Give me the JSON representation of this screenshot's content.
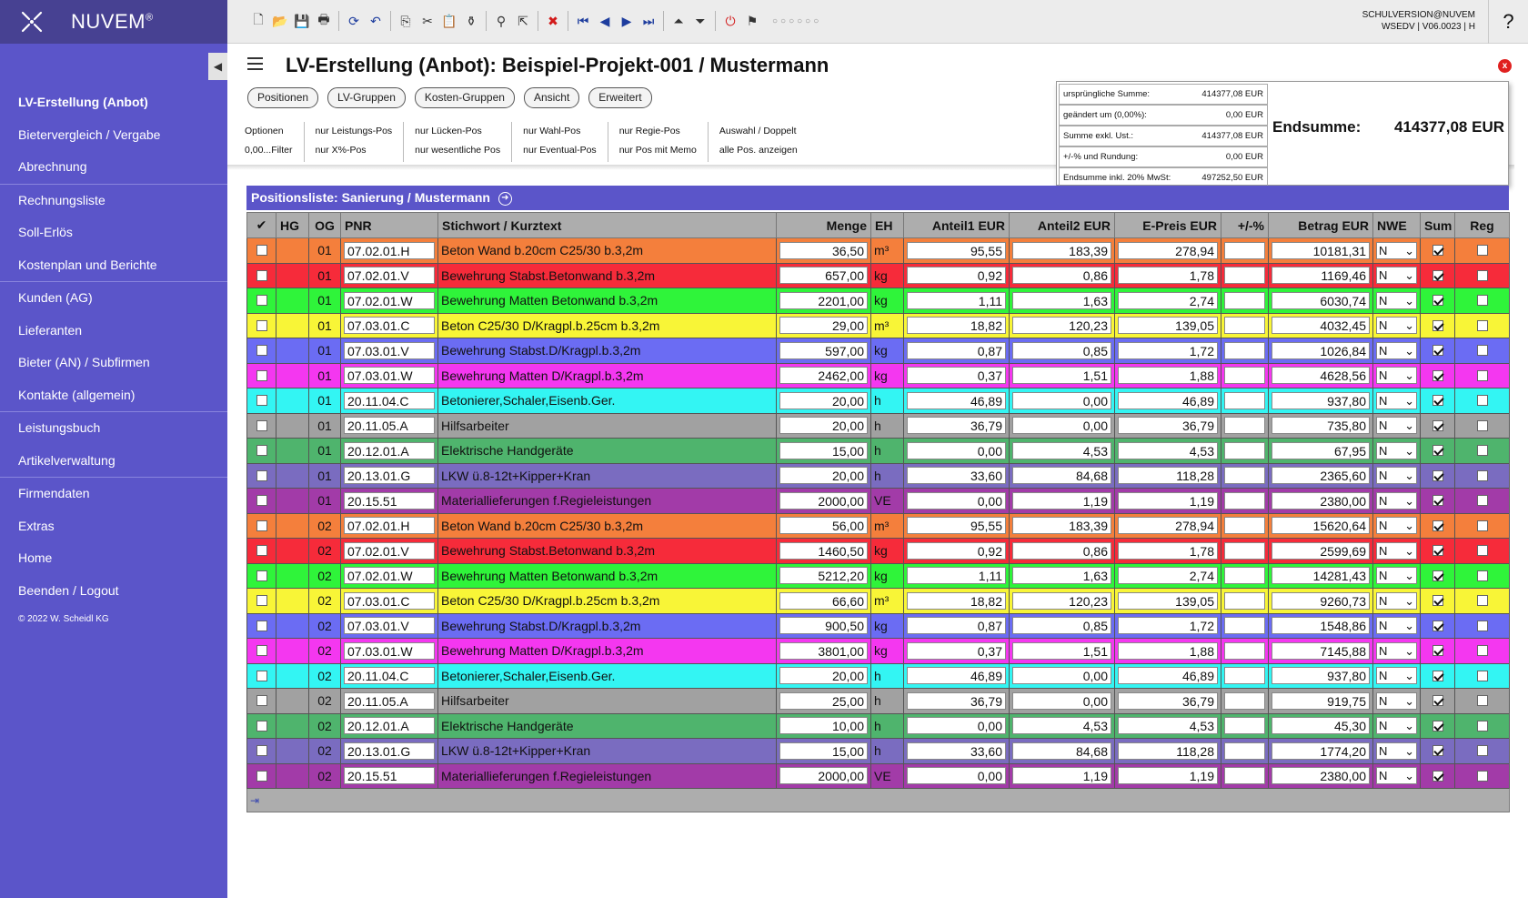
{
  "app": {
    "name": "NUVEM",
    "trademark": "®"
  },
  "user": {
    "line1": "SCHULVERSION@NUVEM",
    "line2": "WSEDV | V06.0023 | H"
  },
  "help_label": "?",
  "sidebar": {
    "groups": [
      [
        {
          "label": "LV-Erstellung (Anbot)",
          "active": true
        },
        {
          "label": "Bietervergleich / Vergabe"
        },
        {
          "label": "Abrechnung"
        }
      ],
      [
        {
          "label": "Rechnungsliste"
        },
        {
          "label": "Soll-Erlös"
        },
        {
          "label": "Kostenplan und Berichte"
        }
      ],
      [
        {
          "label": "Kunden (AG)"
        },
        {
          "label": "Lieferanten"
        },
        {
          "label": "Bieter (AN) / Subfirmen"
        },
        {
          "label": "Kontakte (allgemein)"
        }
      ],
      [
        {
          "label": "Leistungsbuch"
        },
        {
          "label": "Artikelverwaltung"
        }
      ],
      [
        {
          "label": "Firmendaten"
        },
        {
          "label": "Extras"
        },
        {
          "label": "Home"
        },
        {
          "label": "Beenden / Logout"
        }
      ]
    ],
    "copyright": "© 2022 W. Scheidl KG",
    "collapse_icon": "◀"
  },
  "toolbar": {
    "icons": [
      {
        "name": "new-document-icon",
        "glyph": "🗋"
      },
      {
        "name": "open-folder-icon",
        "glyph": "📂"
      },
      {
        "name": "save-icon",
        "glyph": "💾"
      },
      {
        "name": "print-icon",
        "glyph": "🖶"
      },
      {
        "sep": true
      },
      {
        "name": "refresh-icon",
        "glyph": "⟳",
        "color": "blue"
      },
      {
        "name": "undo-icon",
        "glyph": "↶",
        "color": "blue"
      },
      {
        "sep": true
      },
      {
        "name": "copy-icon",
        "glyph": "⎘"
      },
      {
        "name": "cut-icon",
        "glyph": "✂"
      },
      {
        "name": "paste-icon",
        "glyph": "📋"
      },
      {
        "name": "paste-special-icon",
        "glyph": "⚱"
      },
      {
        "sep": true
      },
      {
        "name": "search-icon",
        "glyph": "⚲"
      },
      {
        "name": "export-icon",
        "glyph": "⇱"
      },
      {
        "sep": true
      },
      {
        "name": "delete-icon",
        "glyph": "✖",
        "color": "red"
      },
      {
        "sep": true
      },
      {
        "name": "first-record-icon",
        "glyph": "⏮",
        "color": "blue"
      },
      {
        "name": "previous-record-icon",
        "glyph": "◀",
        "color": "blue"
      },
      {
        "name": "next-record-icon",
        "glyph": "▶",
        "color": "blue"
      },
      {
        "name": "last-record-icon",
        "glyph": "⏭",
        "color": "blue"
      },
      {
        "sep": true
      },
      {
        "name": "collapse-all-icon",
        "glyph": "⏶"
      },
      {
        "name": "expand-all-icon",
        "glyph": "⏷"
      },
      {
        "sep": true
      },
      {
        "name": "power-icon",
        "glyph": "⏻",
        "color": "red"
      },
      {
        "name": "notification-icon",
        "glyph": "⚑"
      }
    ],
    "pager_dots": "○○○○○○"
  },
  "page": {
    "title": "LV-Erstellung (Anbot): Beispiel-Projekt-001 / Mustermann",
    "close_label": "x"
  },
  "tabs": [
    "Positionen",
    "LV-Gruppen",
    "Kosten-Gruppen",
    "Ansicht",
    "Erweitert"
  ],
  "options": [
    [
      "Optionen",
      "0,00...Filter"
    ],
    [
      "nur Leistungs-Pos",
      "nur X%-Pos"
    ],
    [
      "nur Lücken-Pos",
      "nur wesentliche Pos"
    ],
    [
      "nur Wahl-Pos",
      "nur Eventual-Pos"
    ],
    [
      "nur Regie-Pos",
      "nur Pos mit Memo"
    ],
    [
      "Auswahl / Doppelt",
      "alle Pos. anzeigen"
    ]
  ],
  "summary": {
    "rows": [
      {
        "label": "ursprüngliche Summe:",
        "value": "414377,08 EUR"
      },
      {
        "label": "geändert um (0,00%):",
        "value": "0,00 EUR"
      },
      {
        "label": "Summe exkl. Ust.:",
        "value": "414377,08 EUR"
      },
      {
        "label": "+/-% und Rundung:",
        "value": "0,00 EUR"
      },
      {
        "label": "Endsumme inkl. 20% MwSt:",
        "value": "497252,50 EUR"
      }
    ],
    "endsumme_label": "Endsumme:",
    "endsumme_value": "414377,08 EUR"
  },
  "list": {
    "title": "Positionsliste: Sanierung / Mustermann",
    "columns": [
      "✔",
      "HG",
      "OG",
      "PNR",
      "Stichwort / Kurztext",
      "Menge",
      "EH",
      "Anteil1 EUR",
      "Anteil2 EUR",
      "E-Preis EUR",
      "+/-%",
      "Betrag EUR",
      "NWE",
      "Sum",
      "Reg"
    ],
    "footer_icon": "⇥",
    "rows": [
      {
        "color": "#f47f3c",
        "og": "01",
        "pnr": "07.02.01.H",
        "text": "Beton Wand b.20cm C25/30 b.3,2m",
        "menge": "36,50",
        "eh": "m³",
        "a1": "95,55",
        "a2": "183,39",
        "ep": "278,94",
        "pm": "",
        "betrag": "10181,31",
        "nwe": "N",
        "sum": true,
        "reg": false
      },
      {
        "color": "#f62b3a",
        "og": "01",
        "pnr": "07.02.01.V",
        "text": "Bewehrung Stabst.Betonwand b.3,2m",
        "menge": "657,00",
        "eh": "kg",
        "a1": "0,92",
        "a2": "0,86",
        "ep": "1,78",
        "pm": "",
        "betrag": "1169,46",
        "nwe": "N",
        "sum": true,
        "reg": false
      },
      {
        "color": "#2ff43a",
        "og": "01",
        "pnr": "07.02.01.W",
        "text": "Bewehrung Matten Betonwand b.3,2m",
        "menge": "2201,00",
        "eh": "kg",
        "a1": "1,11",
        "a2": "1,63",
        "ep": "2,74",
        "pm": "",
        "betrag": "6030,74",
        "nwe": "N",
        "sum": true,
        "reg": false
      },
      {
        "color": "#f8f537",
        "og": "01",
        "pnr": "07.03.01.C",
        "text": "Beton C25/30 D/Kragpl.b.25cm b.3,2m",
        "menge": "29,00",
        "eh": "m³",
        "a1": "18,82",
        "a2": "120,23",
        "ep": "139,05",
        "pm": "",
        "betrag": "4032,45",
        "nwe": "N",
        "sum": true,
        "reg": false
      },
      {
        "color": "#6b6cf3",
        "og": "01",
        "pnr": "07.03.01.V",
        "text": "Bewehrung Stabst.D/Kragpl.b.3,2m",
        "menge": "597,00",
        "eh": "kg",
        "a1": "0,87",
        "a2": "0,85",
        "ep": "1,72",
        "pm": "",
        "betrag": "1026,84",
        "nwe": "N",
        "sum": true,
        "reg": false
      },
      {
        "color": "#f437f0",
        "og": "01",
        "pnr": "07.03.01.W",
        "text": "Bewehrung Matten D/Kragpl.b.3,2m",
        "menge": "2462,00",
        "eh": "kg",
        "a1": "0,37",
        "a2": "1,51",
        "ep": "1,88",
        "pm": "",
        "betrag": "4628,56",
        "nwe": "N",
        "sum": true,
        "reg": false
      },
      {
        "color": "#33f5f3",
        "og": "01",
        "pnr": "20.11.04.C",
        "text": "Betonierer,Schaler,Eisenb.Ger.",
        "menge": "20,00",
        "eh": "h",
        "a1": "46,89",
        "a2": "0,00",
        "ep": "46,89",
        "pm": "",
        "betrag": "937,80",
        "nwe": "N",
        "sum": true,
        "reg": false
      },
      {
        "color": "#a1a1a1",
        "og": "01",
        "pnr": "20.11.05.A",
        "text": "Hilfsarbeiter",
        "menge": "20,00",
        "eh": "h",
        "a1": "36,79",
        "a2": "0,00",
        "ep": "36,79",
        "pm": "",
        "betrag": "735,80",
        "nwe": "N",
        "sum": true,
        "reg": false
      },
      {
        "color": "#4fb46d",
        "og": "01",
        "pnr": "20.12.01.A",
        "text": "Elektrische Handgeräte",
        "menge": "15,00",
        "eh": "h",
        "a1": "0,00",
        "a2": "4,53",
        "ep": "4,53",
        "pm": "",
        "betrag": "67,95",
        "nwe": "N",
        "sum": true,
        "reg": false
      },
      {
        "color": "#7a6cc0",
        "og": "01",
        "pnr": "20.13.01.G",
        "text": "LKW ü.8-12t+Kipper+Kran",
        "menge": "20,00",
        "eh": "h",
        "a1": "33,60",
        "a2": "84,68",
        "ep": "118,28",
        "pm": "",
        "betrag": "2365,60",
        "nwe": "N",
        "sum": true,
        "reg": false
      },
      {
        "color": "#a23ba8",
        "og": "01",
        "pnr": "20.15.51",
        "text": "Materiallieferungen f.Regieleistungen",
        "menge": "2000,00",
        "eh": "VE",
        "a1": "0,00",
        "a2": "1,19",
        "ep": "1,19",
        "pm": "",
        "betrag": "2380,00",
        "nwe": "N",
        "sum": true,
        "reg": false
      },
      {
        "color": "#f47f3c",
        "og": "02",
        "pnr": "07.02.01.H",
        "text": "Beton Wand b.20cm C25/30 b.3,2m",
        "menge": "56,00",
        "eh": "m³",
        "a1": "95,55",
        "a2": "183,39",
        "ep": "278,94",
        "pm": "",
        "betrag": "15620,64",
        "nwe": "N",
        "sum": true,
        "reg": false
      },
      {
        "color": "#f62b3a",
        "og": "02",
        "pnr": "07.02.01.V",
        "text": "Bewehrung Stabst.Betonwand b.3,2m",
        "menge": "1460,50",
        "eh": "kg",
        "a1": "0,92",
        "a2": "0,86",
        "ep": "1,78",
        "pm": "",
        "betrag": "2599,69",
        "nwe": "N",
        "sum": true,
        "reg": false
      },
      {
        "color": "#2ff43a",
        "og": "02",
        "pnr": "07.02.01.W",
        "text": "Bewehrung Matten Betonwand b.3,2m",
        "menge": "5212,20",
        "eh": "kg",
        "a1": "1,11",
        "a2": "1,63",
        "ep": "2,74",
        "pm": "",
        "betrag": "14281,43",
        "nwe": "N",
        "sum": true,
        "reg": false
      },
      {
        "color": "#f8f537",
        "og": "02",
        "pnr": "07.03.01.C",
        "text": "Beton C25/30 D/Kragpl.b.25cm b.3,2m",
        "menge": "66,60",
        "eh": "m³",
        "a1": "18,82",
        "a2": "120,23",
        "ep": "139,05",
        "pm": "",
        "betrag": "9260,73",
        "nwe": "N",
        "sum": true,
        "reg": false
      },
      {
        "color": "#6b6cf3",
        "og": "02",
        "pnr": "07.03.01.V",
        "text": "Bewehrung Stabst.D/Kragpl.b.3,2m",
        "menge": "900,50",
        "eh": "kg",
        "a1": "0,87",
        "a2": "0,85",
        "ep": "1,72",
        "pm": "",
        "betrag": "1548,86",
        "nwe": "N",
        "sum": true,
        "reg": false
      },
      {
        "color": "#f437f0",
        "og": "02",
        "pnr": "07.03.01.W",
        "text": "Bewehrung Matten D/Kragpl.b.3,2m",
        "menge": "3801,00",
        "eh": "kg",
        "a1": "0,37",
        "a2": "1,51",
        "ep": "1,88",
        "pm": "",
        "betrag": "7145,88",
        "nwe": "N",
        "sum": true,
        "reg": false
      },
      {
        "color": "#33f5f3",
        "og": "02",
        "pnr": "20.11.04.C",
        "text": "Betonierer,Schaler,Eisenb.Ger.",
        "menge": "20,00",
        "eh": "h",
        "a1": "46,89",
        "a2": "0,00",
        "ep": "46,89",
        "pm": "",
        "betrag": "937,80",
        "nwe": "N",
        "sum": true,
        "reg": false
      },
      {
        "color": "#a1a1a1",
        "og": "02",
        "pnr": "20.11.05.A",
        "text": "Hilfsarbeiter",
        "menge": "25,00",
        "eh": "h",
        "a1": "36,79",
        "a2": "0,00",
        "ep": "36,79",
        "pm": "",
        "betrag": "919,75",
        "nwe": "N",
        "sum": true,
        "reg": false
      },
      {
        "color": "#4fb46d",
        "og": "02",
        "pnr": "20.12.01.A",
        "text": "Elektrische Handgeräte",
        "menge": "10,00",
        "eh": "h",
        "a1": "0,00",
        "a2": "4,53",
        "ep": "4,53",
        "pm": "",
        "betrag": "45,30",
        "nwe": "N",
        "sum": true,
        "reg": false
      },
      {
        "color": "#7a6cc0",
        "og": "02",
        "pnr": "20.13.01.G",
        "text": "LKW ü.8-12t+Kipper+Kran",
        "menge": "15,00",
        "eh": "h",
        "a1": "33,60",
        "a2": "84,68",
        "ep": "118,28",
        "pm": "",
        "betrag": "1774,20",
        "nwe": "N",
        "sum": true,
        "reg": false
      },
      {
        "color": "#a23ba8",
        "og": "02",
        "pnr": "20.15.51",
        "text": "Materiallieferungen f.Regieleistungen",
        "menge": "2000,00",
        "eh": "VE",
        "a1": "0,00",
        "a2": "1,19",
        "ep": "1,19",
        "pm": "",
        "betrag": "2380,00",
        "nwe": "N",
        "sum": true,
        "reg": false
      }
    ]
  }
}
